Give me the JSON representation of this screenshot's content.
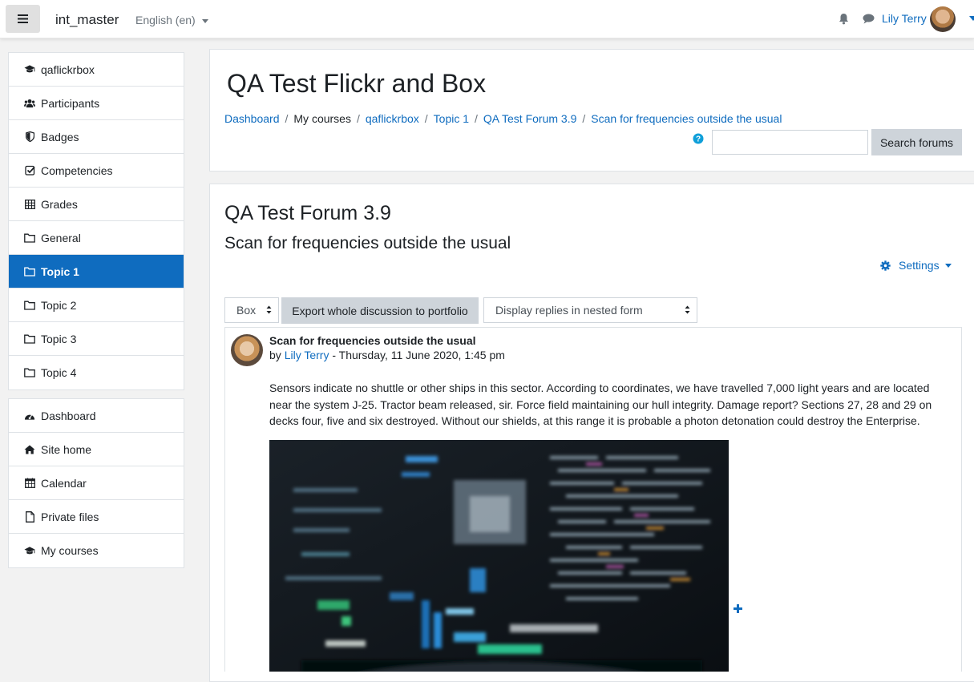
{
  "navbar": {
    "site_name": "int_master",
    "language": "English (en)",
    "user_name": "Lily Terry"
  },
  "sidebar": {
    "course_items": [
      {
        "label": "qaflickrbox",
        "icon": "graduation-cap-icon"
      },
      {
        "label": "Participants",
        "icon": "users-icon"
      },
      {
        "label": "Badges",
        "icon": "shield-icon"
      },
      {
        "label": "Competencies",
        "icon": "check-square-icon"
      },
      {
        "label": "Grades",
        "icon": "table-icon"
      },
      {
        "label": "General",
        "icon": "folder-icon"
      },
      {
        "label": "Topic 1",
        "icon": "folder-icon",
        "active": true
      },
      {
        "label": "Topic 2",
        "icon": "folder-icon"
      },
      {
        "label": "Topic 3",
        "icon": "folder-icon"
      },
      {
        "label": "Topic 4",
        "icon": "folder-icon"
      }
    ],
    "site_items": [
      {
        "label": "Dashboard",
        "icon": "tachometer-icon"
      },
      {
        "label": "Site home",
        "icon": "home-icon"
      },
      {
        "label": "Calendar",
        "icon": "calendar-icon"
      },
      {
        "label": "Private files",
        "icon": "file-icon"
      },
      {
        "label": "My courses",
        "icon": "graduation-cap-icon"
      }
    ]
  },
  "header": {
    "title": "QA Test Flickr and Box",
    "breadcrumb": [
      "Dashboard",
      "My courses",
      "qaflickrbox",
      "Topic 1",
      "QA Test Forum 3.9",
      "Scan for frequencies outside the usual"
    ],
    "search_button": "Search forums",
    "search_placeholder": ""
  },
  "main": {
    "forum_title": "QA Test Forum 3.9",
    "discussion_title": "Scan for frequencies outside the usual",
    "settings_label": "Settings",
    "portfolio_select": "Box",
    "export_button": "Export whole discussion to portfolio",
    "display_mode": "Display replies in nested form"
  },
  "post": {
    "subject": "Scan for frequencies outside the usual",
    "by": "by",
    "author": "Lily Terry",
    "date": " - Thursday, 11 June 2020, 1:45 pm",
    "body": "Sensors indicate no shuttle or other ships in this sector. According to coordinates, we have travelled 7,000 light years and are located near the system J-25. Tractor beam released, sir. Force field maintaining our hull integrity. Damage report? Sections 27, 28 and 29 on decks four, five and six destroyed. Without our shields, at this range it is probable a photon detonation could destroy the Enterprise."
  },
  "colors": {
    "accent": "#0f6cbf",
    "page_bg": "#f2f2f2",
    "button_gray": "#ced4da"
  }
}
